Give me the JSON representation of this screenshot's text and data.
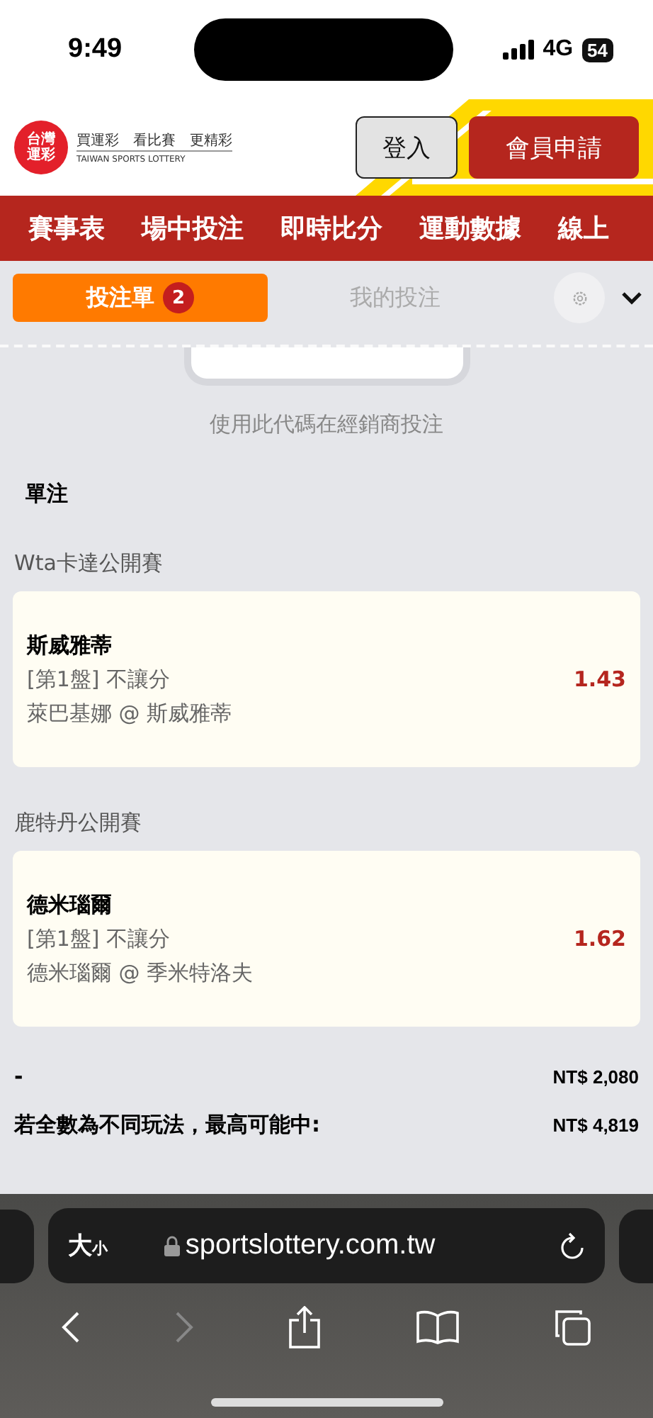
{
  "status_bar": {
    "time": "9:49",
    "network": "4G",
    "battery": "54"
  },
  "header": {
    "logo_mark": [
      "台灣",
      "運彩"
    ],
    "logo_slogan": "買運彩　看比賽　更精彩",
    "logo_english": "TAIWAN SPORTS LOTTERY",
    "buttons": [
      {
        "label": "登入",
        "kind": "secondary"
      },
      {
        "label": "會員申請",
        "kind": "primary"
      }
    ]
  },
  "nav": {
    "items": [
      "賽事表",
      "場中投注",
      "即時比分",
      "運動數據",
      "線上"
    ]
  },
  "betslip": {
    "tabs": [
      {
        "label": "投注單",
        "badge": "2",
        "selected": true
      },
      {
        "label": "我的投注",
        "selected": false
      }
    ],
    "code_hint": "使用此代碼在經銷商投注",
    "section_title": "單注",
    "groups": [
      {
        "league": "Wta卡達公開賽",
        "bet": {
          "title": "斯威雅蒂",
          "market": "[第1盤] 不讓分",
          "selection": "萊巴基娜 @ 斯威雅蒂",
          "odds": "1.43"
        }
      },
      {
        "league": "鹿特丹公開賽",
        "bet": {
          "title": "德米瑙爾",
          "market": "[第1盤] 不讓分",
          "selection": "德米瑙爾 @ 季米特洛夫",
          "odds": "1.62"
        }
      }
    ],
    "summary": [
      {
        "label": "-",
        "value": "NT$ 2,080"
      },
      {
        "label": "若全數為不同玩法，最高可能中:",
        "value": "NT$ 4,819"
      }
    ]
  },
  "browser": {
    "text_size": {
      "large": "大",
      "small": "小"
    },
    "url": "sportslottery.com.tw"
  }
}
